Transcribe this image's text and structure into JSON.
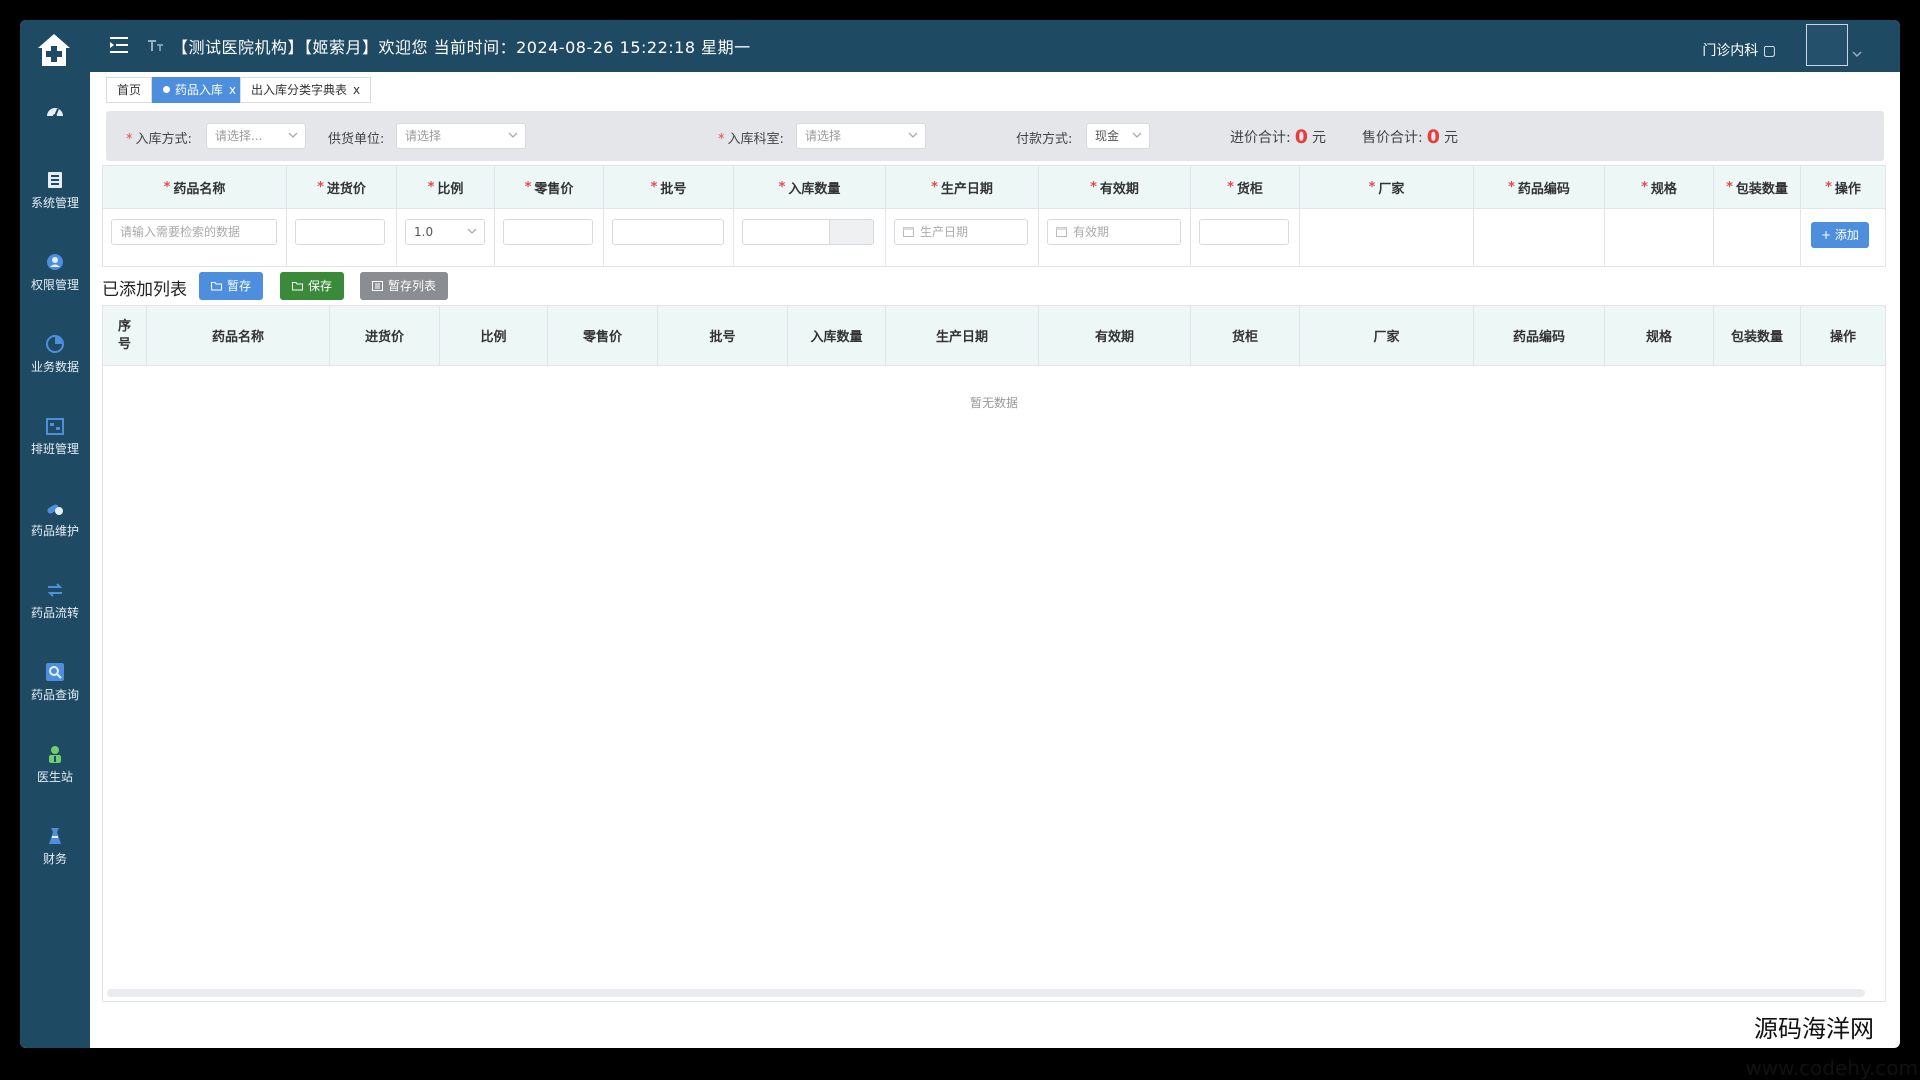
{
  "sidebar": {
    "items": [
      {
        "label": "系统管理",
        "icon": "system-icon"
      },
      {
        "label": "权限管理",
        "icon": "permission-icon"
      },
      {
        "label": "业务数据",
        "icon": "business-data-icon"
      },
      {
        "label": "排班管理",
        "icon": "schedule-icon"
      },
      {
        "label": "药品维护",
        "icon": "drug-maintain-icon"
      },
      {
        "label": "药品流转",
        "icon": "drug-transfer-icon"
      },
      {
        "label": "药品查询",
        "icon": "drug-query-icon"
      },
      {
        "label": "医生站",
        "icon": "doctor-station-icon"
      },
      {
        "label": "财务",
        "icon": "finance-icon"
      }
    ]
  },
  "header": {
    "title": "【测试医院机构】【姬萦月】欢迎您  当前时间：2024-08-26 15:22:18 星期一",
    "department": "门诊内科 ▢"
  },
  "tabs": [
    {
      "label": "首页",
      "active": false,
      "closable": false
    },
    {
      "label": "药品入库",
      "active": true,
      "closable": true
    },
    {
      "label": "出入库分类字典表",
      "active": false,
      "closable": true
    }
  ],
  "filter": {
    "inbound_method_label": "入库方式:",
    "inbound_method_placeholder": "请选择...",
    "supplier_label": "供货单位:",
    "supplier_placeholder": "请选择",
    "dept_label": "入库科室:",
    "dept_placeholder": "请选择",
    "payment_label": "付款方式:",
    "payment_value": "现金",
    "purchase_total_label": "进价合计:",
    "purchase_total_value": "0",
    "sale_total_label": "售价合计:",
    "sale_total_value": "0",
    "currency": "元"
  },
  "input_table": {
    "columns": [
      "药品名称",
      "进货价",
      "比例",
      "零售价",
      "批号",
      "入库数量",
      "生产日期",
      "有效期",
      "货柜",
      "厂家",
      "药品编码",
      "规格",
      "包装数量",
      "操作"
    ],
    "drug_name_placeholder": "请输入需要检索的数据",
    "ratio_value": "1.0",
    "production_date_placeholder": "生产日期",
    "expiry_placeholder": "有效期",
    "add_button": "+ 添加"
  },
  "added_list": {
    "title": "已添加列表",
    "temp_save": "暂存",
    "save": "保存",
    "temp_list": "暂存列表",
    "columns": [
      "序号",
      "药品名称",
      "进货价",
      "比例",
      "零售价",
      "批号",
      "入库数量",
      "生产日期",
      "有效期",
      "货柜",
      "厂家",
      "药品编码",
      "规格",
      "包装数量",
      "操作"
    ],
    "empty_text": "暂无数据"
  },
  "watermark": "源码海洋网",
  "watermark_url": "www.codehy.com",
  "colors": {
    "sidebar": "#1f4a63",
    "accent": "#4d8fdc",
    "save": "#3a8a3a",
    "total": "#e83d3d"
  }
}
